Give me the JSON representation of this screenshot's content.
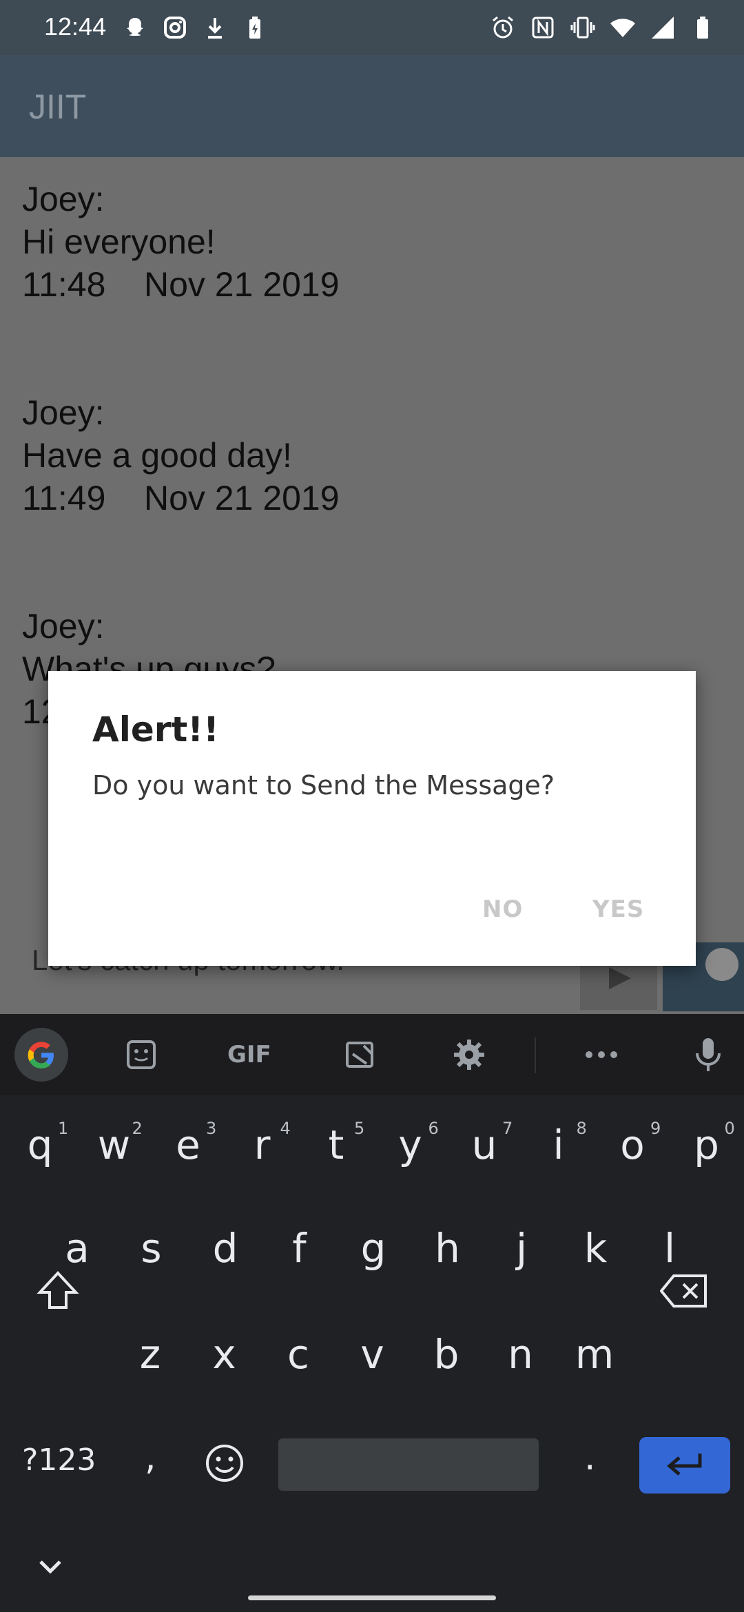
{
  "status_bar": {
    "time": "12:44",
    "left_icons": [
      "snapchat-icon",
      "instagram-icon",
      "download-icon",
      "battery-charging-icon"
    ],
    "right_icons": [
      "alarm-icon",
      "nfc-icon",
      "vibrate-icon",
      "wifi-icon",
      "signal-icon",
      "battery-icon"
    ]
  },
  "app_bar": {
    "title": "JIIT"
  },
  "messages": [
    {
      "sender": "Joey:",
      "text": "Hi everyone!",
      "time": "11:48",
      "date": "Nov 21 2019"
    },
    {
      "sender": "Joey:",
      "text": "Have a good day!",
      "time": "11:49",
      "date": "Nov 21 2019"
    },
    {
      "sender": "Joey:",
      "text": "What's up guys?",
      "time": "12",
      "date": ""
    }
  ],
  "composer": {
    "value": "Let's catch up tomorrow."
  },
  "dialog": {
    "title": "Alert!!",
    "message": "Do you want to Send the Message?",
    "negative_label": "NO",
    "positive_label": "YES"
  },
  "keyboard": {
    "toolbar_icons": [
      "google-icon",
      "sticker-icon",
      "gif-icon",
      "clipboard-icon",
      "settings-icon",
      "more-icon",
      "mic-icon"
    ],
    "gif_label": "GIF",
    "row1": [
      "q",
      "w",
      "e",
      "r",
      "t",
      "y",
      "u",
      "i",
      "o",
      "p"
    ],
    "row1_hints": [
      "1",
      "2",
      "3",
      "4",
      "5",
      "6",
      "7",
      "8",
      "9",
      "0"
    ],
    "row2": [
      "a",
      "s",
      "d",
      "f",
      "g",
      "h",
      "j",
      "k",
      "l"
    ],
    "row3": [
      "z",
      "x",
      "c",
      "v",
      "b",
      "n",
      "m"
    ],
    "symbols_label": "?123",
    "comma": ",",
    "period": ".",
    "accent_color": "#3367d6"
  }
}
